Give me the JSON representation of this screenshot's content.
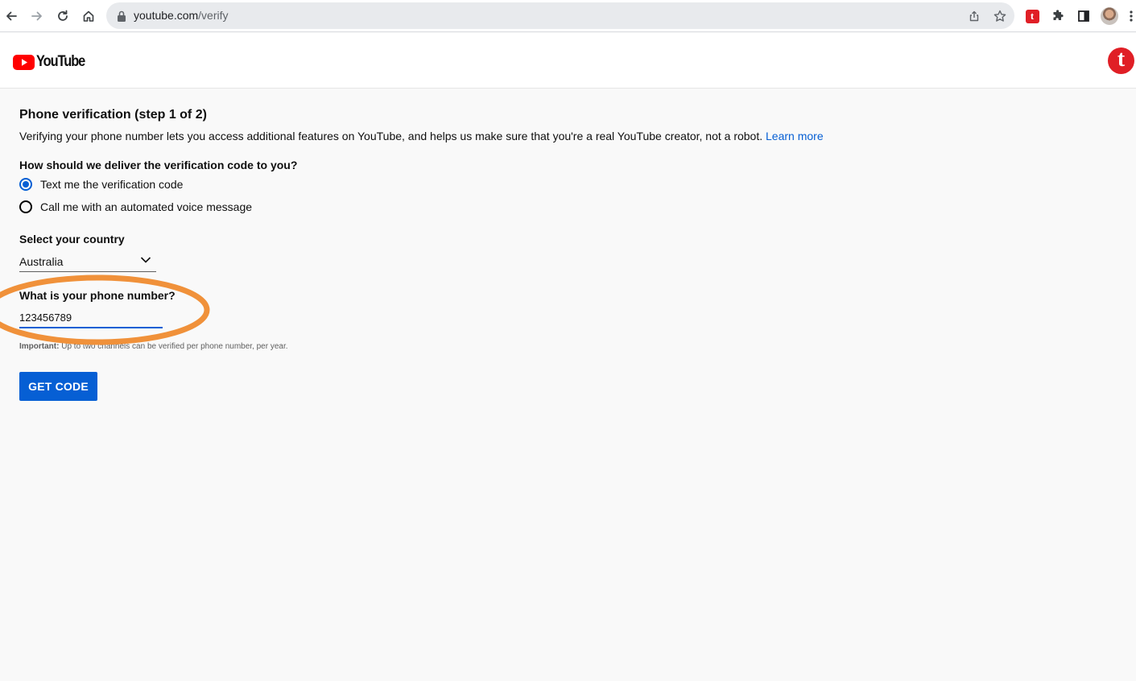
{
  "browser": {
    "url_host": "youtube.com",
    "url_path": "/verify"
  },
  "header": {
    "logo_text": "YouTube",
    "avatar_letter": "t"
  },
  "verification": {
    "title": "Phone verification (step 1 of 2)",
    "description": "Verifying your phone number lets you access additional features on YouTube, and helps us make sure that you're a real YouTube creator, not a robot. ",
    "learn_more": "Learn more",
    "delivery_question": "How should we deliver the verification code to you?",
    "options": [
      {
        "label": "Text me the verification code",
        "selected": true
      },
      {
        "label": "Call me with an automated voice message",
        "selected": false
      }
    ],
    "country_label": "Select your country",
    "country_value": "Australia",
    "phone_label": "What is your phone number?",
    "phone_value": "123456789",
    "important_prefix": "Important:",
    "important_text": " Up to two channels can be verified per phone number, per year.",
    "get_code_label": "GET CODE"
  },
  "colors": {
    "accent": "#065fd4",
    "annotation": "#f0913a",
    "yt_red": "#ff0000"
  }
}
